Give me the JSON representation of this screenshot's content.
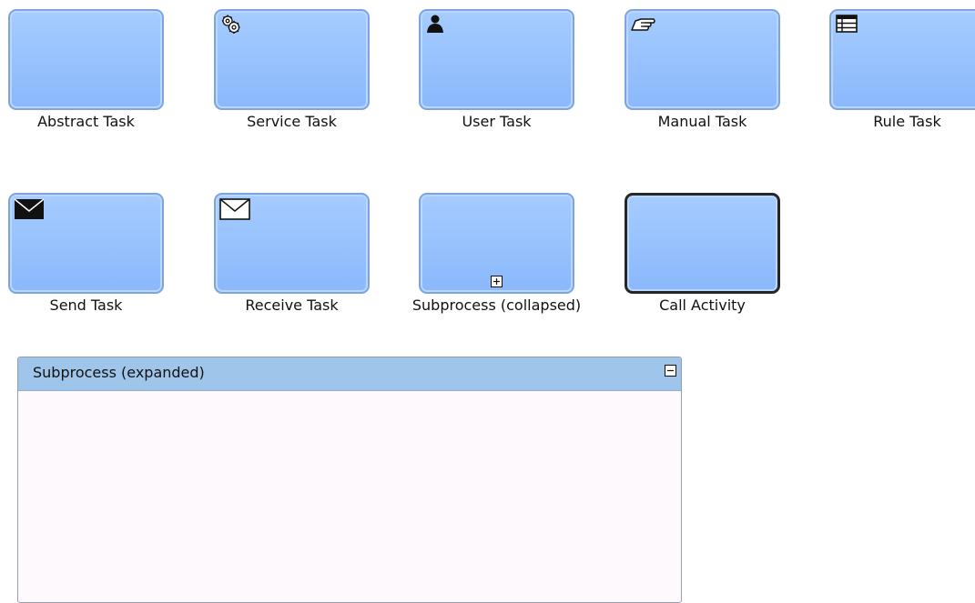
{
  "tasks": {
    "abstract": "Abstract Task",
    "service": "Service Task",
    "user": "User Task",
    "manual": "Manual Task",
    "rule": "Rule Task",
    "send": "Send Task",
    "receive": "Receive Task",
    "subprocess_collapsed": "Subprocess (collapsed)",
    "call_activity": "Call Activity"
  },
  "expanded_subprocess": {
    "title": "Subprocess (expanded)"
  },
  "icons": {
    "service": "gear-icon",
    "user": "user-icon",
    "manual": "hand-icon",
    "rule": "table-icon",
    "send": "envelope-filled-icon",
    "receive": "envelope-outline-icon",
    "collapse_marker": "plus-square-icon",
    "expand_marker": "minus-square-icon"
  },
  "colors": {
    "task_fill": "#9ac3fd",
    "task_border": "#7fa4db",
    "call_activity_border": "#262626",
    "expanded_header": "#9fc6ea",
    "expanded_body": "#fdf9fd"
  }
}
